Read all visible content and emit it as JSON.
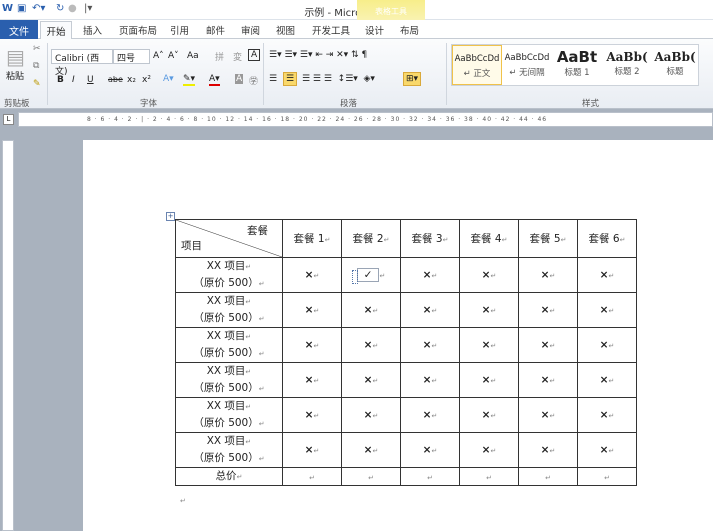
{
  "window": {
    "title": "示例 - Microsoft Word",
    "tool_context": "表格工具"
  },
  "tabs": {
    "file": "文件",
    "home": "开始",
    "items": [
      "插入",
      "页面布局",
      "引用",
      "邮件",
      "审阅",
      "视图",
      "开发工具",
      "设计",
      "布局"
    ]
  },
  "ribbon": {
    "clipboard": {
      "paste": "粘贴",
      "label": "剪贴板"
    },
    "font": {
      "name": "Calibri (西文)",
      "size": "四号",
      "label": "字体",
      "bold": "B",
      "italic": "I",
      "underline": "U",
      "strike": "abe",
      "sub": "x₂",
      "sup": "x²",
      "grow": "A˄",
      "shrink": "A˅",
      "case": "Aa"
    },
    "paragraph": {
      "label": "段落"
    },
    "styles": {
      "label": "样式",
      "items": [
        {
          "preview": "AaBbCcDd",
          "name": "↵ 正文"
        },
        {
          "preview": "AaBbCcDd",
          "name": "↵ 无间隔"
        },
        {
          "preview": "AaBt",
          "name": "标题 1"
        },
        {
          "preview": "AaBb(",
          "name": "标题 2"
        },
        {
          "preview": "AaBb(",
          "name": "标题"
        }
      ]
    }
  },
  "ruler": {
    "text": "8 · 6 · 4 · 2 · | · 2 · 4 · 6 · 8 · 10 · 12 · 14 · 16 · 18 · 20 · 22 · 24 · 26 · 28 · 30 · 32 · 34 · 36 · 38 · 40 · 42 · 44 · 46"
  },
  "table": {
    "corner_top": "套餐",
    "corner_bottom": "项目",
    "headers": [
      "套餐 1",
      "套餐 2",
      "套餐 3",
      "套餐 4",
      "套餐 5",
      "套餐 6"
    ],
    "row_label_line1": "XX 项目",
    "row_label_line2": "（原价 500）",
    "cross": "×",
    "check": "✓",
    "rows": 6,
    "checked_cell": {
      "row": 1,
      "col": 2
    },
    "total_label": "总价"
  },
  "marks": {
    "para": "↵"
  },
  "colors": {
    "file_tab": "#2a5fae",
    "highlight": "#f9d86b"
  }
}
